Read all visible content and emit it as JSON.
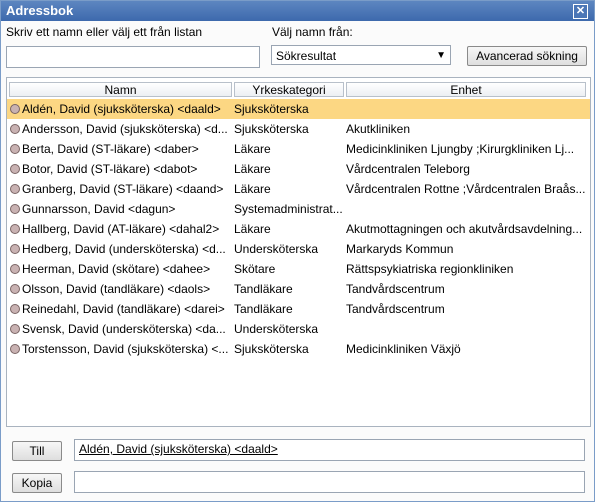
{
  "window": {
    "title": "Adressbok",
    "close_symbol": "✕"
  },
  "search": {
    "label": "Skriv ett namn eller välj ett från listan",
    "value": "",
    "placeholder": ""
  },
  "source": {
    "label": "Välj namn från:",
    "selected": "Sökresultat"
  },
  "advanced_button": "Avancerad sökning",
  "table": {
    "columns": [
      "Namn",
      "Yrkeskategori",
      "Enhet"
    ],
    "rows": [
      {
        "name": "Aldén, David (sjuksköterska) <daald>",
        "category": "Sjuksköterska",
        "unit": "",
        "selected": true
      },
      {
        "name": "Andersson, David (sjuksköterska) <d...",
        "category": "Sjuksköterska",
        "unit": "Akutkliniken"
      },
      {
        "name": "Berta, David (ST-läkare) <daber>",
        "category": "Läkare",
        "unit": "Medicinkliniken Ljungby ;Kirurgkliniken Lj..."
      },
      {
        "name": "Botor, David (ST-läkare) <dabot>",
        "category": "Läkare",
        "unit": "Vårdcentralen Teleborg"
      },
      {
        "name": "Granberg, David (ST-läkare) <daand>",
        "category": "Läkare",
        "unit": "Vårdcentralen Rottne ;Vårdcentralen Braås..."
      },
      {
        "name": "Gunnarsson, David <dagun>",
        "category": "Systemadministrat...",
        "unit": ""
      },
      {
        "name": "Hallberg, David (AT-läkare) <dahal2>",
        "category": "Läkare",
        "unit": "Akutmottagningen och akutvårdsavdelning..."
      },
      {
        "name": "Hedberg, David (undersköterska) <d...",
        "category": "Undersköterska",
        "unit": "Markaryds Kommun"
      },
      {
        "name": "Heerman, David (skötare) <dahee>",
        "category": "Skötare",
        "unit": "Rättspsykiatriska regionkliniken"
      },
      {
        "name": "Olsson, David (tandläkare) <daols>",
        "category": "Tandläkare",
        "unit": "Tandvårdscentrum"
      },
      {
        "name": "Reinedahl, David (tandläkare) <darei>",
        "category": "Tandläkare",
        "unit": "Tandvårdscentrum"
      },
      {
        "name": "Svensk, David (undersköterska) <da...",
        "category": "Undersköterska",
        "unit": ""
      },
      {
        "name": "Torstensson, David (sjuksköterska) <...",
        "category": "Sjuksköterska",
        "unit": "Medicinkliniken Växjö"
      }
    ]
  },
  "to": {
    "button": "Till",
    "value": "Aldén, David (sjuksköterska) <daald>"
  },
  "copy": {
    "button": "Kopia",
    "value": ""
  },
  "icons": {
    "close": "close-icon",
    "dropdown": "chevron-down-icon",
    "row_marker": "person-status-icon"
  }
}
